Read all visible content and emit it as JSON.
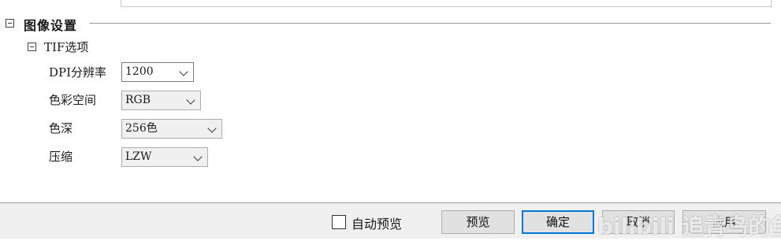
{
  "section": {
    "title": "图像设置"
  },
  "tif": {
    "title": "TIF选项",
    "fields": [
      {
        "label": "DPI分辨率",
        "value": "1200"
      },
      {
        "label": "色彩空间",
        "value": "RGB"
      },
      {
        "label": "色深",
        "value": "256色"
      },
      {
        "label": "压缩",
        "value": "LZW"
      }
    ]
  },
  "footer": {
    "auto_preview_label": "自动预览",
    "auto_preview_checked": false,
    "preview_label": "预览",
    "ok_label": "确定",
    "cancel_label": "取消",
    "apply_label": "应用"
  },
  "watermark": {
    "text": "bilibili 追青鸟的鱼"
  },
  "colors": {
    "default_button_border": "#0078d7",
    "footer_bg": "#f0f0f0"
  },
  "icons": {
    "expander": "minus-box-icon",
    "dropdown": "chevron-down-icon"
  }
}
